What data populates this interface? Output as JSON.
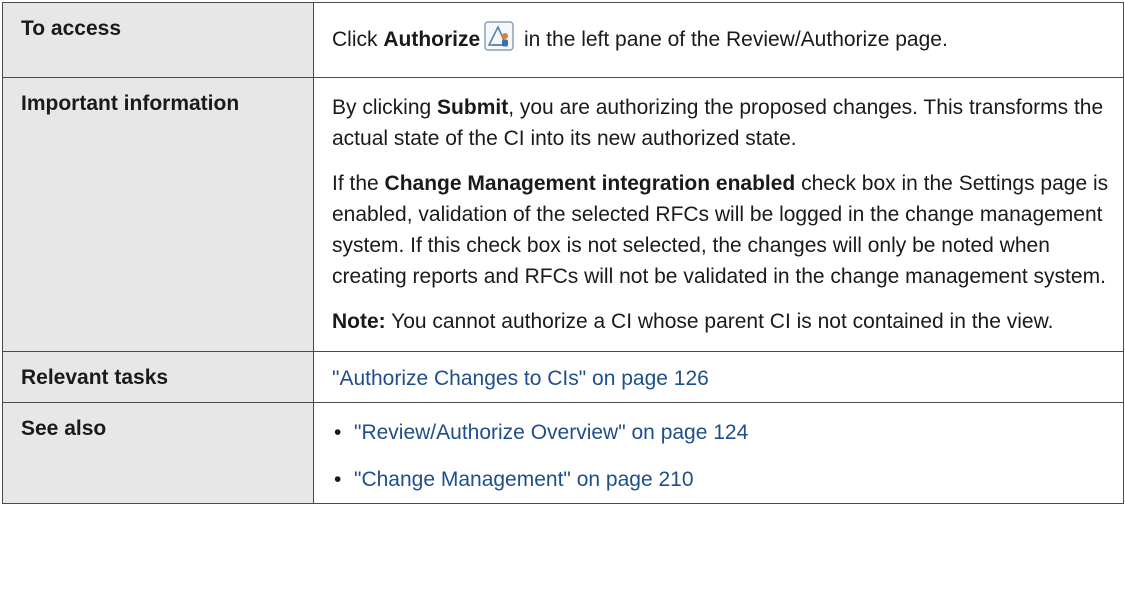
{
  "rows": {
    "access": {
      "label": "To access",
      "text_before": "Click ",
      "bold": "Authorize",
      "text_after": " in the left pane of the Review/Authorize page."
    },
    "important": {
      "label": "Important information",
      "p1_before": "By clicking ",
      "p1_bold": "Submit",
      "p1_after": ", you are authorizing the proposed changes. This transforms the actual state of the CI into its new authorized state.",
      "p2_before": "If the ",
      "p2_bold": "Change Management integration enabled",
      "p2_after": " check box in the Settings page is enabled, validation of the selected RFCs will be logged in the change management system. If this check box is not selected, the changes will only be noted when creating reports and RFCs will not be validated in the change management system.",
      "note_bold": "Note:",
      "note_text": " You cannot authorize a CI whose parent CI is not contained in the view."
    },
    "tasks": {
      "label": "Relevant tasks",
      "link": "\"Authorize Changes to CIs\" on page 126"
    },
    "see_also": {
      "label": "See also",
      "links": [
        "\"Review/Authorize Overview\" on page 124",
        "\"Change Management\" on page 210"
      ]
    }
  },
  "icons": {
    "authorize": "authorize-icon"
  },
  "colors": {
    "header_bg": "#e7e7e7",
    "link": "#1f4e8c",
    "border": "#4a4a4a"
  }
}
